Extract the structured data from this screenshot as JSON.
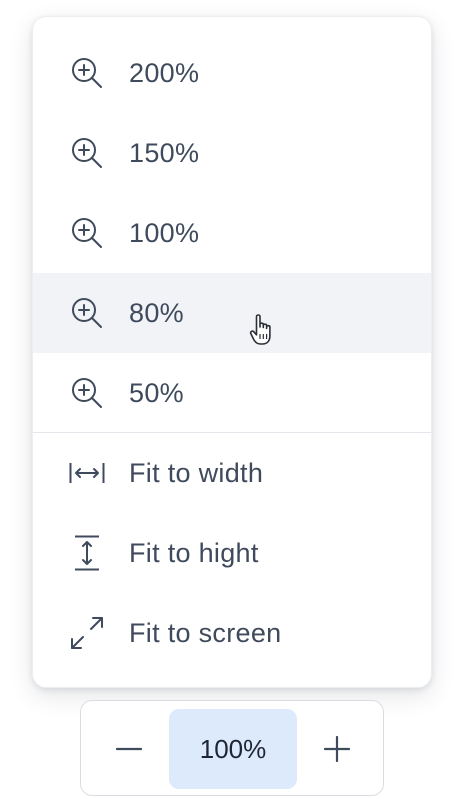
{
  "zoom_menu": {
    "items": [
      {
        "label": "200%",
        "icon": "zoom-in-icon"
      },
      {
        "label": "150%",
        "icon": "zoom-in-icon"
      },
      {
        "label": "100%",
        "icon": "zoom-in-icon"
      },
      {
        "label": "80%",
        "icon": "zoom-in-icon",
        "hovered": true
      },
      {
        "label": "50%",
        "icon": "zoom-in-icon"
      },
      {
        "label": "Fit to width",
        "icon": "fit-width-icon"
      },
      {
        "label": "Fit to hight",
        "icon": "fit-height-icon"
      },
      {
        "label": "Fit to screen",
        "icon": "fit-screen-icon"
      }
    ]
  },
  "zoom_control": {
    "decrease_icon": "minus-icon",
    "value": "100%",
    "increase_icon": "plus-icon"
  },
  "colors": {
    "text": "#3f4a5c",
    "hover_background": "#f1f3f7",
    "current_zoom_background": "#dceafc",
    "border": "#d9dde3"
  }
}
